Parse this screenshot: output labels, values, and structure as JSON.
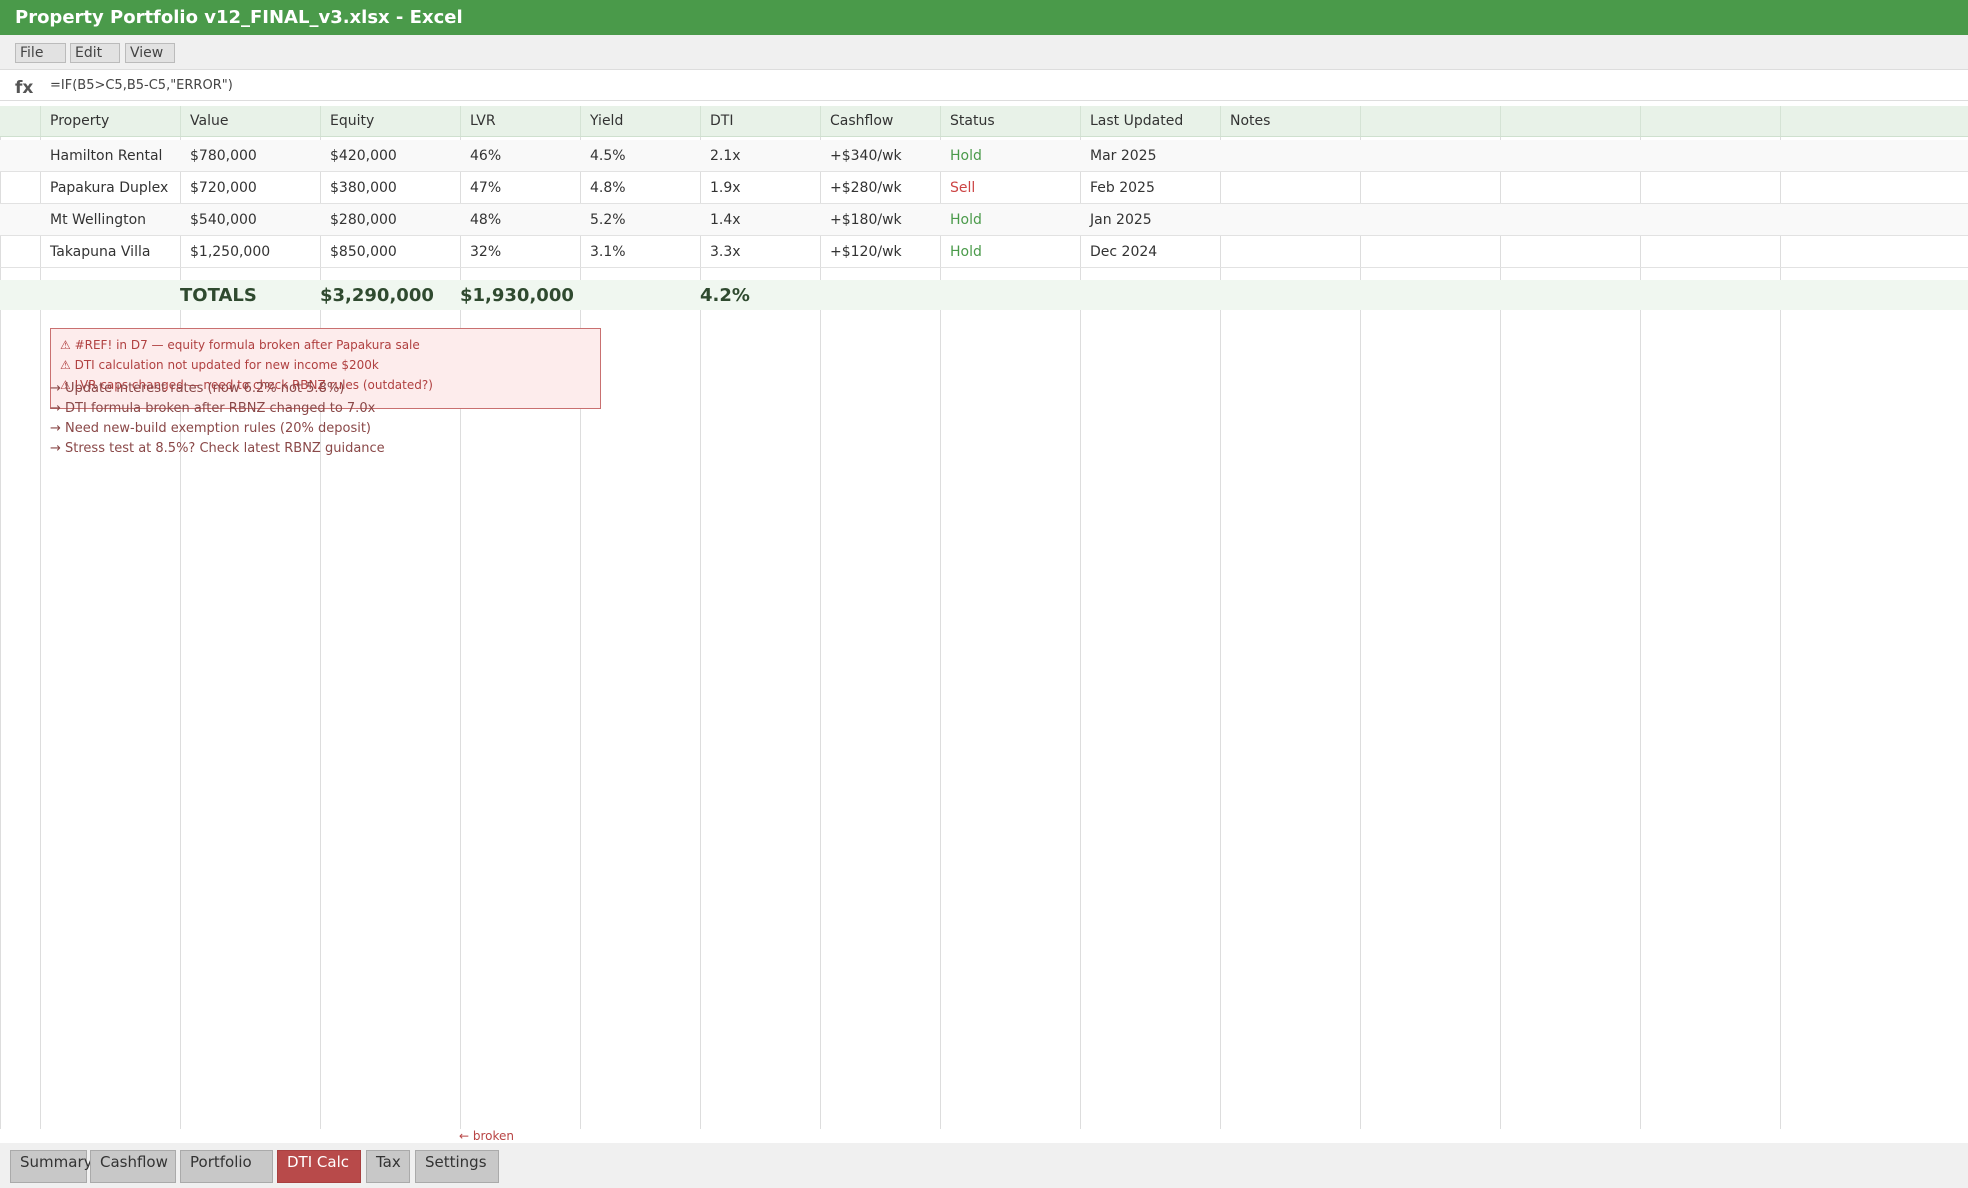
{
  "window": {
    "title": "Property Portfolio v12_FINAL_v3.xlsx - Excel"
  },
  "menu": [
    "File",
    "Edit",
    "View"
  ],
  "formula_bar": {
    "fx_label": "fx",
    "formula": "=IF(B5>C5,B5-C5,\"ERROR\")"
  },
  "sheet": {
    "columns": [
      "Property",
      "Value",
      "Equity",
      "LVR",
      "Yield",
      "DTI",
      "Cashflow",
      "Status",
      "Last Updated",
      "Notes"
    ],
    "rows": [
      {
        "property": "Hamilton Rental",
        "value": "$780,000",
        "equity": "$420,000",
        "lvr": "46%",
        "yield": "4.5%",
        "dti": "2.1x",
        "cashflow": "+$340/wk",
        "status": "Hold",
        "last_updated": "Mar 2025",
        "notes": ""
      },
      {
        "property": "Papakura Duplex",
        "value": "$720,000",
        "equity": "$380,000",
        "lvr": "47%",
        "yield": "4.8%",
        "dti": "1.9x",
        "cashflow": "+$280/wk",
        "status": "Sell",
        "last_updated": "Feb 2025",
        "notes": ""
      },
      {
        "property": "Mt Wellington",
        "value": "$540,000",
        "equity": "$280,000",
        "lvr": "48%",
        "yield": "5.2%",
        "dti": "1.4x",
        "cashflow": "+$180/wk",
        "status": "Hold",
        "last_updated": "Jan 2025",
        "notes": ""
      },
      {
        "property": "Takapuna Villa",
        "value": "$1,250,000",
        "equity": "$850,000",
        "lvr": "32%",
        "yield": "3.1%",
        "dti": "3.3x",
        "cashflow": "+$120/wk",
        "status": "Hold",
        "last_updated": "Dec 2024",
        "notes": ""
      }
    ],
    "totals": {
      "label": "TOTALS",
      "value": "$3,290,000",
      "equity": "$1,930,000",
      "yield": "4.2%"
    }
  },
  "alerts": [
    "⚠ #REF! in D7 — equity formula broken after Papakura sale",
    "⚠ DTI calculation not updated for new income $200k",
    "⚠ LVR caps changed — need to check RBNZ rules (outdated?)"
  ],
  "notes": [
    "→ Update interest rates (now 6.2% not 5.8%)",
    "→ DTI formula broken after RBNZ changed to 7.0x",
    "→ Need new-build exemption rules (20% deposit)",
    "→ Stress test at 8.5%? Check latest RBNZ guidance"
  ],
  "broken_marker": "← broken",
  "tabs": [
    {
      "label": "Summary",
      "active": false
    },
    {
      "label": "Cashflow",
      "active": false
    },
    {
      "label": "Portfolio",
      "active": false
    },
    {
      "label": "DTI Calc",
      "active": true
    },
    {
      "label": "Tax",
      "active": false
    },
    {
      "label": "Settings",
      "active": false
    }
  ],
  "colors": {
    "title_bar": "#4a9a4a",
    "header_row": "#e8f2e8",
    "hold": "#4a9a4a",
    "sell": "#cc4444",
    "active_tab": "#b84a4a",
    "alert_bg": "#fdecec"
  }
}
